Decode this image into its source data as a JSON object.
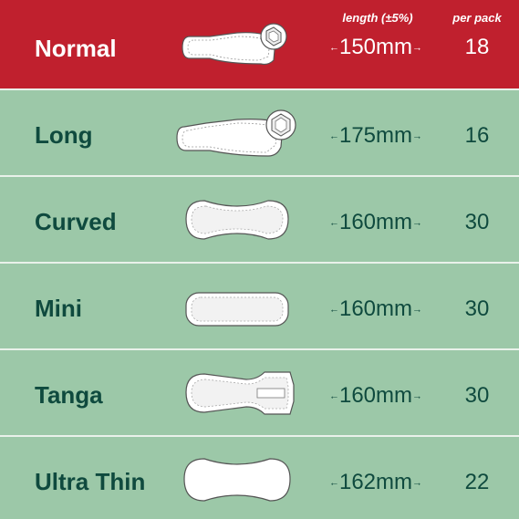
{
  "headers": {
    "length": "length (±5%)",
    "per_pack": "per pack"
  },
  "arrows": {
    "left": "←",
    "right": "→"
  },
  "colors": {
    "header_bg": "#c0202e",
    "row_bg": "#9cc8a8",
    "text_dark": "#0f4a3e",
    "divider": "#e9f1ea"
  },
  "rows": [
    {
      "name": "Normal",
      "length": "150mm",
      "per_pack": "18",
      "icon": "normal-pad-icon"
    },
    {
      "name": "Long",
      "length": "175mm",
      "per_pack": "16",
      "icon": "long-pad-icon"
    },
    {
      "name": "Curved",
      "length": "160mm",
      "per_pack": "30",
      "icon": "curved-pad-icon"
    },
    {
      "name": "Mini",
      "length": "160mm",
      "per_pack": "30",
      "icon": "mini-pad-icon"
    },
    {
      "name": "Tanga",
      "length": "160mm",
      "per_pack": "30",
      "icon": "tanga-pad-icon"
    },
    {
      "name": "Ultra Thin",
      "length": "162mm",
      "per_pack": "22",
      "icon": "ultra-thin-pad-icon"
    }
  ]
}
